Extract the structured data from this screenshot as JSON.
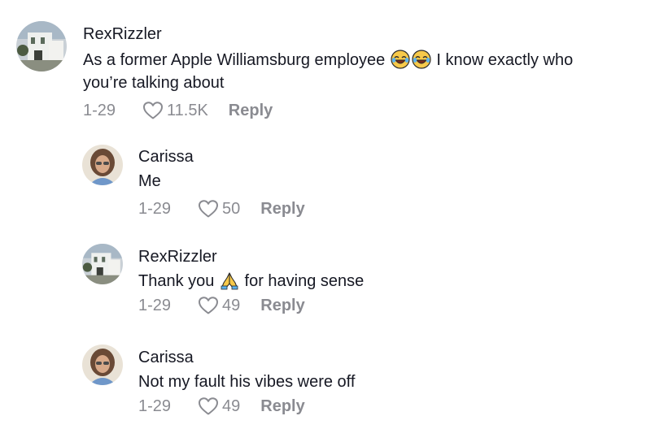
{
  "comments": [
    {
      "username": "RexRizzler",
      "text_before_emoji": "As a former Apple Williamsburg employee",
      "emoji": [
        "joy-emoji",
        "joy-emoji"
      ],
      "text_after_emoji": "I know exactly who",
      "text_line2": "you’re talking about",
      "date": "1-29",
      "likes": "11.5K",
      "reply_label": "Reply"
    },
    {
      "username": "Carissa",
      "text": "Me",
      "date": "1-29",
      "likes": "50",
      "reply_label": "Reply"
    },
    {
      "username": "RexRizzler",
      "text_before_emoji": "Thank you",
      "emoji": [
        "folded-hands-emoji"
      ],
      "text_after_emoji": "for having sense",
      "date": "1-29",
      "likes": "49",
      "reply_label": "Reply"
    },
    {
      "username": "Carissa",
      "text": "Not my fault his vibes were off",
      "date": "1-29",
      "likes": "49",
      "reply_label": "Reply"
    }
  ],
  "colors": {
    "text": "#161823",
    "meta": "#8a8b91"
  }
}
